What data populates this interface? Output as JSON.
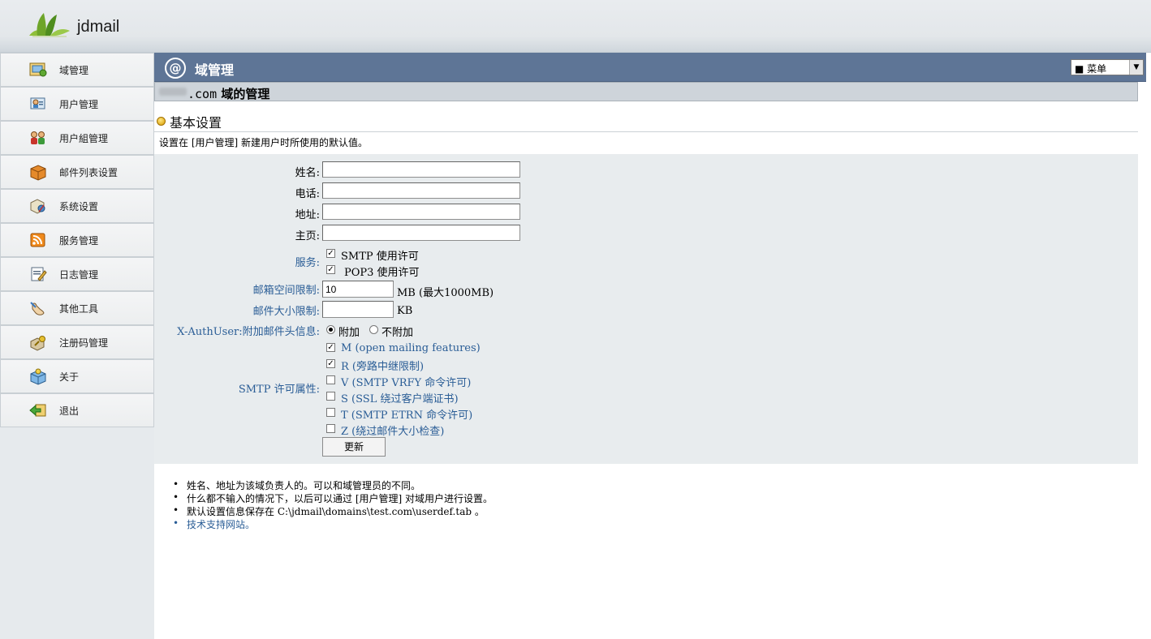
{
  "app": {
    "name": "jdmail"
  },
  "sidebar": {
    "items": [
      {
        "label": "域管理",
        "icon": "domain-icon"
      },
      {
        "label": "用户管理",
        "icon": "user-card-icon"
      },
      {
        "label": "用户組管理",
        "icon": "user-group-icon"
      },
      {
        "label": "邮件列表设置",
        "icon": "mailing-list-box-icon"
      },
      {
        "label": "系统设置",
        "icon": "system-settings-icon"
      },
      {
        "label": "服务管理",
        "icon": "rss-service-icon"
      },
      {
        "label": "日志管理",
        "icon": "log-edit-icon"
      },
      {
        "label": "其他工具",
        "icon": "tools-hand-icon"
      },
      {
        "label": "注册码管理",
        "icon": "registration-key-icon"
      },
      {
        "label": "关于",
        "icon": "about-box-icon"
      },
      {
        "label": "退出",
        "icon": "logout-arrow-icon"
      }
    ]
  },
  "titlebar": {
    "title": "域管理",
    "icon": "at-icon",
    "menu_value": "■ 菜单"
  },
  "domain": {
    "suffix": ".com",
    "header_tail": "域的管理"
  },
  "section": {
    "title": "基本设置",
    "desc": "设置在 [用户管理] 新建用户时所使用的默认值。"
  },
  "form": {
    "name_label": "姓名:",
    "name_value": "",
    "phone_label": "电话:",
    "phone_value": "",
    "address_label": "地址:",
    "address_value": "",
    "homepage_label": "主页:",
    "homepage_value": "",
    "services_label": "服务:",
    "smtp_label": "SMTP 使用许可",
    "smtp_checked": true,
    "pop3_label": "POP3 使用许可",
    "pop3_checked": true,
    "mailbox_limit_label": "邮箱空间限制:",
    "mailbox_limit_value": "10",
    "mailbox_unit": "MB (最大1000MB)",
    "mail_size_label": "邮件大小限制:",
    "mail_size_value": "",
    "mail_size_unit": "KB",
    "xauth_label": "X-AuthUser:附加邮件头信息:",
    "xauth_options": [
      {
        "label": "附加",
        "selected": true
      },
      {
        "label": "不附加",
        "selected": false
      }
    ],
    "smtp_perm_label": "SMTP 许可属性:",
    "smtp_perms": [
      {
        "label": "M (open mailing features)",
        "checked": true
      },
      {
        "label": "R (旁路中继限制)",
        "checked": true
      },
      {
        "label": "V (SMTP VRFY 命令许可)",
        "checked": false
      },
      {
        "label": "S (SSL 绕过客户端证书)",
        "checked": false
      },
      {
        "label": "T (SMTP ETRN 命令许可)",
        "checked": false
      },
      {
        "label": "Z (绕过邮件大小检查)",
        "checked": false
      }
    ],
    "update_label": "更新"
  },
  "notes": [
    "姓名、地址为该域负责人的。可以和域管理员的不同。",
    "什么都不输入的情况下，以后可以通过 [用户管理] 对域用户进行设置。",
    "默认设置信息保存在 C:\\jdmail\\domains\\test.com\\userdef.tab 。",
    "技术支持网站。"
  ]
}
